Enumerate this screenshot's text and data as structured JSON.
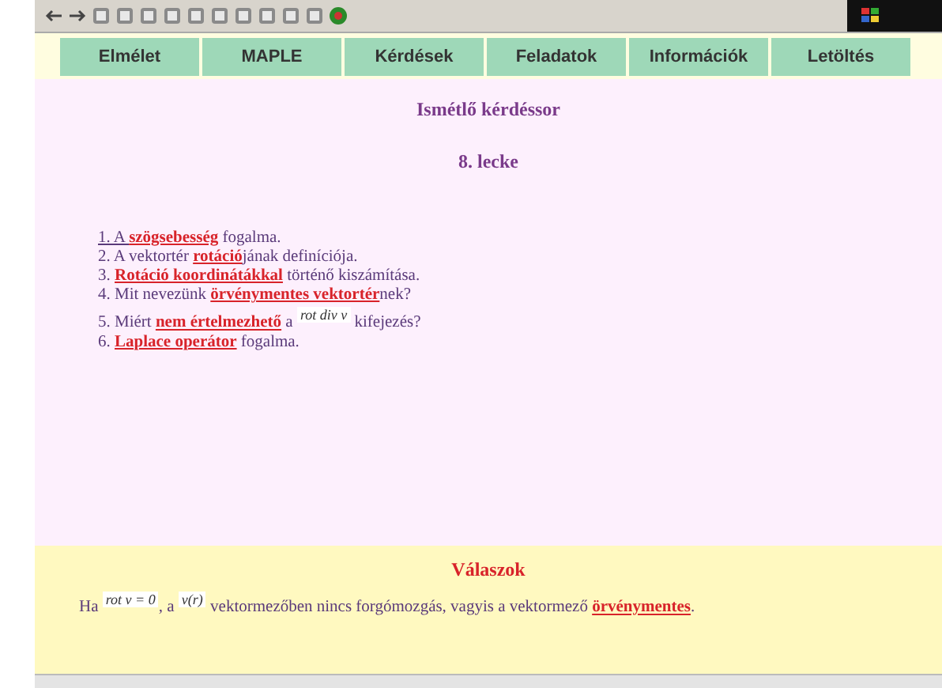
{
  "nav": {
    "tabs": [
      {
        "label": "Elmélet",
        "selected": false
      },
      {
        "label": "MAPLE",
        "selected": false
      },
      {
        "label": "Kérdések",
        "selected": false
      },
      {
        "label": "Feladatok",
        "selected": false
      },
      {
        "label": "Információk",
        "selected": false
      },
      {
        "label": "Letöltés",
        "selected": false
      }
    ]
  },
  "content": {
    "title": "Ismétlő kérdéssor",
    "subtitle": "8. lecke",
    "questions": [
      {
        "parts": [
          {
            "kind": "link",
            "text": "1. A "
          },
          {
            "kind": "hot",
            "text": "szögsebesség"
          },
          {
            "kind": "text",
            "text": " fogalma."
          }
        ]
      },
      {
        "parts": [
          {
            "kind": "text",
            "text": "2. A vektortér "
          },
          {
            "kind": "hot",
            "text": "rotáció"
          },
          {
            "kind": "text",
            "text": "jának definíciója."
          }
        ]
      },
      {
        "parts": [
          {
            "kind": "text",
            "text": "3. "
          },
          {
            "kind": "hot",
            "text": "Rotáció koordinátákkal"
          },
          {
            "kind": "text",
            "text": " történő kiszámítása."
          }
        ]
      },
      {
        "parts": [
          {
            "kind": "text",
            "text": "4. Mit nevezünk "
          },
          {
            "kind": "hot",
            "text": "örvénymentes vektortér"
          },
          {
            "kind": "text",
            "text": "nek?"
          }
        ]
      },
      {
        "parts": [
          {
            "kind": "text",
            "text": "5. Miért "
          },
          {
            "kind": "hot",
            "text": "nem értelmezhető"
          },
          {
            "kind": "text",
            "text": " a "
          },
          {
            "kind": "formula",
            "text": "rot div v"
          },
          {
            "kind": "text",
            "text": " kifejezés?"
          }
        ]
      },
      {
        "parts": [
          {
            "kind": "text",
            "text": "6. "
          },
          {
            "kind": "hot",
            "text": "Laplace operátor"
          },
          {
            "kind": "text",
            "text": " fogalma."
          }
        ]
      }
    ]
  },
  "answers": {
    "title": "Válaszok",
    "parts": [
      {
        "kind": "text",
        "text": "Ha "
      },
      {
        "kind": "formula",
        "text": "rot v = 0"
      },
      {
        "kind": "text",
        "text": ", a "
      },
      {
        "kind": "formula",
        "text": "v(r)"
      },
      {
        "kind": "text",
        "text": " vektormezőben nincs forgómozgás, vagyis a vektormező "
      },
      {
        "kind": "hot",
        "text": "örvénymentes"
      },
      {
        "kind": "text",
        "text": "."
      }
    ]
  }
}
